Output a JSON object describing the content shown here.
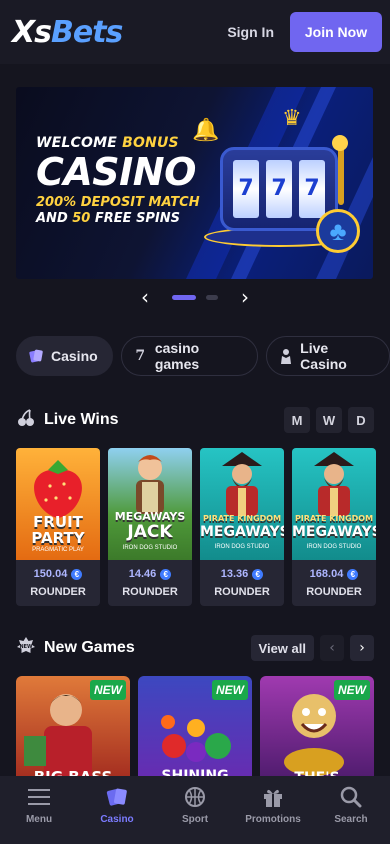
{
  "header": {
    "logo_part1": "Xs",
    "logo_part2": "Bets",
    "signin_label": "Sign In",
    "join_label": "Join Now"
  },
  "banner": {
    "line1_a": "WELCOME ",
    "line1_b": "BONUS",
    "line2": "CASINO",
    "line3_a": "200% DEPOSIT MATCH",
    "line3_b": "AND ",
    "line3_c": "50",
    "line3_d": " FREE SPINS",
    "reels": [
      "7",
      "7",
      "7"
    ]
  },
  "carousel": {
    "prev": "‹",
    "next": "›",
    "slides": 2,
    "active": 0
  },
  "categories": [
    {
      "label": "Casino",
      "icon": "cards-icon",
      "active": true
    },
    {
      "label": "casino games",
      "icon": "seven-icon",
      "active": false
    },
    {
      "label": "Live Casino",
      "icon": "dealer-icon",
      "active": false
    }
  ],
  "live_wins": {
    "title": "Live Wins",
    "filters": [
      "M",
      "W",
      "D"
    ],
    "items": [
      {
        "game": "FRUIT",
        "game2": "PARTY",
        "studio": "PRAGMATIC PLAY",
        "amount": "150.04",
        "user": "ROUNDER",
        "bg": "#f39a1a"
      },
      {
        "game": "MEGAWAYS",
        "game2": "JACK",
        "studio": "IRON DOG STUDIO",
        "amount": "14.46",
        "user": "ROUNDER",
        "bg": "#6aa93a"
      },
      {
        "game": "PIRATE KINGDOM",
        "game2": "MEGAWAYS",
        "studio": "IRON DOG STUDIO",
        "amount": "13.36",
        "user": "ROUNDER",
        "bg": "#18a8a8"
      },
      {
        "game": "PIRATE KINGDOM",
        "game2": "MEGAWAYS",
        "studio": "IRON DOG STUDIO",
        "amount": "168.04",
        "user": "ROUNDER",
        "bg": "#18a8a8"
      }
    ],
    "coin_symbol": "€"
  },
  "new_games": {
    "title": "New Games",
    "view_all": "View all",
    "prev": "‹",
    "next": "›",
    "badge": "NEW",
    "items": [
      {
        "art_text": "BIG BASS",
        "bg": "#b13b2b"
      },
      {
        "art_text": "SHINING",
        "bg": "#3a3fa8"
      },
      {
        "art_text": "THE'S",
        "bg": "#7a2c8a"
      }
    ]
  },
  "bottom_nav": [
    {
      "label": "Menu",
      "icon": "menu-icon",
      "active": false
    },
    {
      "label": "Casino",
      "icon": "casino-cards-icon",
      "active": true
    },
    {
      "label": "Sport",
      "icon": "basketball-icon",
      "active": false
    },
    {
      "label": "Promotions",
      "icon": "gift-icon",
      "active": false
    },
    {
      "label": "Search",
      "icon": "search-icon",
      "active": false
    }
  ]
}
